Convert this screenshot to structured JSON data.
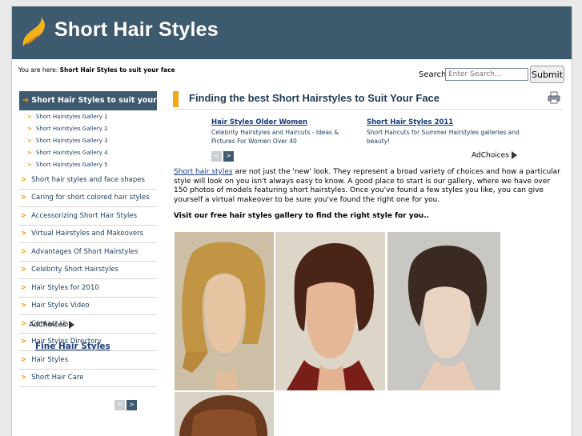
{
  "site": {
    "title": "Short Hair Styles"
  },
  "breadcrumb": {
    "prefix": "You are here: ",
    "current": "Short Hair Styles to suit your face"
  },
  "search": {
    "label": "Search:",
    "placeholder": "Enter Search...",
    "button_label": "Submit"
  },
  "sidebar": {
    "active_item": "Short Hair Styles to suit your face",
    "sub_items": [
      "Short Hairstyles Gallery 1",
      "Short Hairstyles Gallery 2",
      "Short Hairstyles Gallery 3",
      "Short Hairstyles Gallery 4",
      "Short Hairstyles Gallery 5"
    ],
    "items": [
      "Short hair styles and face shapes",
      "Caring for short colored hair styles",
      "Accessorizing Short Hair Styles",
      "Virtual Hairstyles and Makeovers",
      "Advantages Of Short Hairstyles",
      "Celebrity Short Hairstyles",
      "Hair Styles for 2010",
      "Hair Styles Video",
      "Contact Us",
      "Hair Styles Directory",
      "Hair Styles",
      "Short Hair Care"
    ],
    "adchoices": "AdChoices",
    "fine_hair_link": "Fine Hair Styles"
  },
  "main": {
    "title": "Finding the best Short Hairstyles to Suit Your Face",
    "ads": [
      {
        "title": "Hair Styles Older Women",
        "desc": "Celebrity Hairstyles and Haircuts - Ideas & Pictures For Women Over 40"
      },
      {
        "title": "Short Hair Styles 2011",
        "desc": "Short Haircuts for Summer Hairstyles galleries and beauty!"
      }
    ],
    "adchoices": "AdChoices",
    "intro_link": "Short hair styles",
    "intro_text": " are not just the 'new' look. They represent a broad variety of choices and how a particular style will look on you isn't always easy to know. A good place to start is our gallery, where we have over 150 photos of models featuring short hairstyles. Once you've found a few styles you like, you can give yourself a virtual makeover to be sure you've found the right one for you.",
    "visit_text": "Visit our free hair styles gallery to find the right style for you.."
  },
  "colors": {
    "header_bg": "#3e5a6e",
    "accent": "#f3a712",
    "link": "#1a3a8a"
  }
}
